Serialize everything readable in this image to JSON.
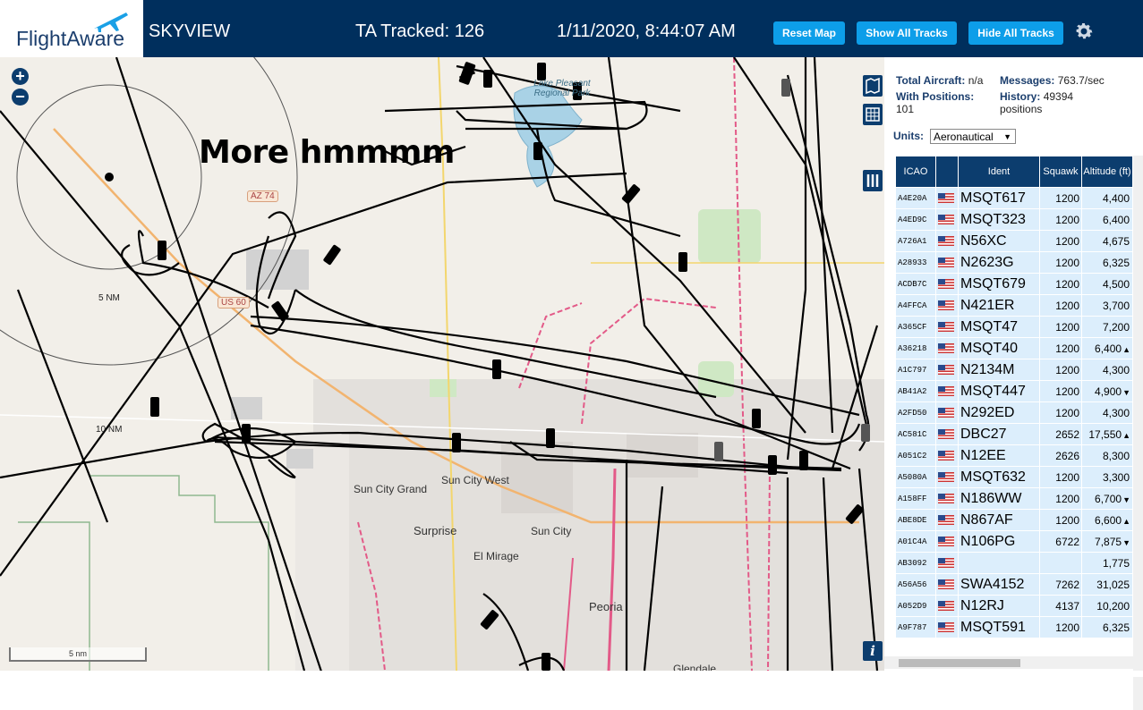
{
  "header": {
    "logo_text": "FlightAware",
    "product": "SKYVIEW",
    "tracked": "TA Tracked: 126",
    "datetime": "1/11/2020, 8:44:07 AM",
    "buttons": [
      "Reset Map",
      "Show All Tracks",
      "Hide All Tracks"
    ],
    "settings_icon": "gear-icon",
    "brand_color": "#002f5d",
    "button_color": "#0d9ee9"
  },
  "map": {
    "annotation": "More hmmmm",
    "places": [
      "Sun City Grand",
      "Sun City West",
      "Surprise",
      "Sun City",
      "El Mirage",
      "Peoria",
      "Glendale"
    ],
    "shields": [
      "AZ 74",
      "US 60"
    ],
    "lake_label": "Lake Pleasant Regional Park",
    "ring_labels": [
      "5 NM",
      "10 NM"
    ],
    "scale_label": "5 nm",
    "zoom_in": "+",
    "zoom_out": "−",
    "controls": [
      "map-icon",
      "grid-icon",
      "columns-icon",
      "info-icon"
    ],
    "info_label": "i"
  },
  "stats": {
    "total_aircraft_label": "Total Aircraft:",
    "total_aircraft": "n/a",
    "messages_label": "Messages:",
    "messages": "763.7/sec",
    "with_positions_label": "With Positions:",
    "with_positions": "101",
    "history_label": "History:",
    "history": "49394 positions",
    "units_label": "Units:",
    "units_value": "Aeronautical"
  },
  "table": {
    "headers": [
      "ICAO",
      "",
      "Ident",
      "Squawk",
      "Altitude (ft)"
    ],
    "rows": [
      {
        "icao": "A4E20A",
        "ident": "MSQT617",
        "squawk": "1200",
        "alt": "4,400",
        "trend": ""
      },
      {
        "icao": "A4ED9C",
        "ident": "MSQT323",
        "squawk": "1200",
        "alt": "6,400",
        "trend": ""
      },
      {
        "icao": "A726A1",
        "ident": "N56XC",
        "squawk": "1200",
        "alt": "4,675",
        "trend": ""
      },
      {
        "icao": "A28933",
        "ident": "N2623G",
        "squawk": "1200",
        "alt": "6,325",
        "trend": ""
      },
      {
        "icao": "ACDB7C",
        "ident": "MSQT679",
        "squawk": "1200",
        "alt": "4,500",
        "trend": ""
      },
      {
        "icao": "A4FFCA",
        "ident": "N421ER",
        "squawk": "1200",
        "alt": "3,700",
        "trend": ""
      },
      {
        "icao": "A365CF",
        "ident": "MSQT47",
        "squawk": "1200",
        "alt": "7,200",
        "trend": ""
      },
      {
        "icao": "A36218",
        "ident": "MSQT40",
        "squawk": "1200",
        "alt": "6,400",
        "trend": "▲"
      },
      {
        "icao": "A1C797",
        "ident": "N2134M",
        "squawk": "1200",
        "alt": "4,300",
        "trend": ""
      },
      {
        "icao": "AB41A2",
        "ident": "MSQT447",
        "squawk": "1200",
        "alt": "4,900",
        "trend": "▼"
      },
      {
        "icao": "A2FD50",
        "ident": "N292ED",
        "squawk": "1200",
        "alt": "4,300",
        "trend": ""
      },
      {
        "icao": "AC581C",
        "ident": "DBC27",
        "squawk": "2652",
        "alt": "17,550",
        "trend": "▲"
      },
      {
        "icao": "A051C2",
        "ident": "N12EE",
        "squawk": "2626",
        "alt": "8,300",
        "trend": ""
      },
      {
        "icao": "A5080A",
        "ident": "MSQT632",
        "squawk": "1200",
        "alt": "3,300",
        "trend": ""
      },
      {
        "icao": "A158FF",
        "ident": "N186WW",
        "squawk": "1200",
        "alt": "6,700",
        "trend": "▼"
      },
      {
        "icao": "ABE8DE",
        "ident": "N867AF",
        "squawk": "1200",
        "alt": "6,600",
        "trend": "▲"
      },
      {
        "icao": "A01C4A",
        "ident": "N106PG",
        "squawk": "6722",
        "alt": "7,875",
        "trend": "▼"
      },
      {
        "icao": "AB3092",
        "ident": "",
        "squawk": "",
        "alt": "1,775",
        "trend": ""
      },
      {
        "icao": "A56A56",
        "ident": "SWA4152",
        "squawk": "7262",
        "alt": "31,025",
        "trend": ""
      },
      {
        "icao": "A052D9",
        "ident": "N12RJ",
        "squawk": "4137",
        "alt": "10,200",
        "trend": ""
      },
      {
        "icao": "A9F787",
        "ident": "MSQT591",
        "squawk": "1200",
        "alt": "6,325",
        "trend": ""
      }
    ],
    "row_color": "#dceefc",
    "header_color": "#0c3d6e"
  }
}
